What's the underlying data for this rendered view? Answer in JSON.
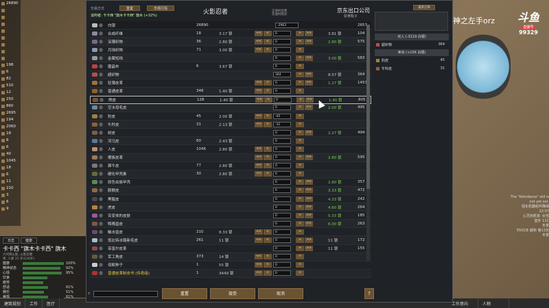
{
  "header": {
    "mode_label": "交易方式",
    "btn1": "重置",
    "btn2": "市场行情",
    "negotiator": "谈判者: 卡卡西 \"旗木卡卡西\" 旗木 (+32%)",
    "trader_name": "火影忍者",
    "faction": "京东出口公司",
    "faction_sub": "奴隶贩子",
    "positive": "正值时出售",
    "negative": "负值时购买",
    "right_btn": "请求订单"
  },
  "silver": {
    "name": "白银",
    "count": "26890",
    "field": "-2963",
    "trader_count": "2657"
  },
  "rows": [
    {
      "name": "合成纤维",
      "count": "18",
      "price": "3.17 银",
      "field": "0",
      "tprice": "3.81 银",
      "tcnt": "104",
      "g": false,
      "l": true,
      "r": true,
      "col": "#8a8aa0"
    },
    {
      "name": "深薄织物",
      "count": "36",
      "price": "2.80 银",
      "field": "0",
      "tprice": "2.80 银",
      "tcnt": "575",
      "g": true,
      "l": true,
      "r": true,
      "col": "#7a6a8a"
    },
    {
      "name": "月球织物",
      "count": "71",
      "price": "3.00 银",
      "field": "0",
      "tprice": "",
      "tcnt": "",
      "g": false,
      "l": true,
      "r": true,
      "col": "#8a9ab0"
    },
    {
      "name": "金属短线",
      "count": "",
      "price": "",
      "field": "0",
      "tprice": "3.00 银",
      "tcnt": "583",
      "g": true,
      "l": false,
      "r": false,
      "col": "#9a9a9a"
    },
    {
      "name": "魔晶布",
      "count": "6",
      "price": "3.67 银",
      "field": "0",
      "tprice": "",
      "tcnt": "",
      "g": false,
      "l": false,
      "r": true,
      "col": "#c04040"
    },
    {
      "name": "超织物",
      "count": "",
      "price": "",
      "field": "364",
      "tprice": "8.57 银",
      "tcnt": "364",
      "g": false,
      "l": false,
      "r": false,
      "col": "#b05050"
    },
    {
      "name": "轻薄皮革",
      "count": "",
      "price": "",
      "field": "0",
      "tprice": "1.27 银",
      "tcnt": "1453",
      "g": true,
      "l": true,
      "r": false,
      "col": "#a07040"
    },
    {
      "name": "普通皮革",
      "count": "348",
      "price": "1.40 银",
      "field": "0",
      "tprice": "",
      "tcnt": "",
      "g": false,
      "l": true,
      "r": true,
      "col": "#906030"
    },
    {
      "name": "熊皮",
      "count": "128",
      "price": "1.40 银",
      "field": "0",
      "tprice": "1.40 银",
      "tcnt": "805",
      "g": true,
      "l": true,
      "r": true,
      "col": "#7a5030",
      "hl": true
    },
    {
      "name": "空水母毛皮",
      "count": "",
      "price": "",
      "field": "0",
      "tprice": "2.00 银",
      "tcnt": "495",
      "g": true,
      "l": false,
      "r": false,
      "col": "#6a8aa0"
    },
    {
      "name": "豹皮",
      "count": "45",
      "price": "2.00 银",
      "field": "-45",
      "tprice": "",
      "tcnt": "",
      "g": false,
      "l": true,
      "r": true,
      "col": "#a08040"
    },
    {
      "name": "牛羚皮",
      "count": "31",
      "price": "2.13 银",
      "field": "-31",
      "tprice": "",
      "tcnt": "",
      "g": false,
      "l": true,
      "r": true,
      "col": "#8a6040"
    },
    {
      "name": "树皮",
      "count": "",
      "price": "",
      "field": "0",
      "tprice": "2.27 银",
      "tcnt": "494",
      "g": true,
      "l": false,
      "r": false,
      "col": "#7a6040"
    },
    {
      "name": "河马皮",
      "count": "60",
      "price": "2.43 银",
      "field": "0",
      "tprice": "",
      "tcnt": "",
      "g": false,
      "l": false,
      "r": true,
      "col": "#5a7a9a"
    },
    {
      "name": "人皮",
      "count": "1046",
      "price": "2.80 银",
      "field": "0",
      "tprice": "",
      "tcnt": "",
      "g": false,
      "l": true,
      "r": true,
      "col": "#c09070"
    },
    {
      "name": "哪族皮革",
      "count": "",
      "price": "",
      "field": "0",
      "tprice": "2.80 银",
      "tcnt": "595",
      "g": true,
      "l": true,
      "r": false,
      "col": "#9a7a5a"
    },
    {
      "name": "犀牛皮",
      "count": "77",
      "price": "2.80 银",
      "field": "0",
      "tprice": "",
      "tcnt": "",
      "g": false,
      "l": true,
      "r": true,
      "col": "#7a7a7a"
    },
    {
      "name": "硬化甲壳素",
      "count": "30",
      "price": "2.80 银",
      "field": "0",
      "tprice": "",
      "tcnt": "",
      "g": false,
      "l": true,
      "r": true,
      "col": "#6a6a40"
    },
    {
      "name": "原色虫族甲壳",
      "count": "",
      "price": "",
      "field": "0",
      "tprice": "2.80 银",
      "tcnt": "357",
      "g": true,
      "l": false,
      "r": false,
      "col": "#5a8a5a"
    },
    {
      "name": "豚猴皮",
      "count": "",
      "price": "",
      "field": "0",
      "tprice": "3.33 银",
      "tcnt": "472",
      "g": true,
      "l": false,
      "r": false,
      "col": "#8a6a4a"
    },
    {
      "name": "黑猩皮",
      "count": "",
      "price": "",
      "field": "0",
      "tprice": "4.33 银",
      "tcnt": "242",
      "g": true,
      "l": false,
      "r": false,
      "col": "#4a4a4a"
    },
    {
      "name": "虎皮",
      "count": "",
      "price": "",
      "field": "0",
      "tprice": "4.60 银",
      "tcnt": "264",
      "g": true,
      "l": false,
      "r": false,
      "col": "#c08030"
    },
    {
      "name": "突变体的皮肤",
      "count": "",
      "price": "",
      "field": "0",
      "tprice": "5.33 银",
      "tcnt": "185",
      "g": true,
      "l": false,
      "r": false,
      "col": "#9a5a9a"
    },
    {
      "name": "鸭嘴兽皮",
      "count": "",
      "price": "",
      "field": "0",
      "tprice": "6.00 银",
      "tcnt": "263",
      "g": true,
      "l": false,
      "r": false,
      "col": "#7a5a4a"
    },
    {
      "name": "触击兽皮",
      "count": "210",
      "price": "8.33 银",
      "field": "0",
      "tprice": "",
      "tcnt": "",
      "g": false,
      "l": true,
      "r": true,
      "col": "#6a4a6a"
    },
    {
      "name": "低比特冰路新毛皮",
      "count": "261",
      "price": "11 银",
      "field": "0",
      "tprice": "11 银",
      "tcnt": "172",
      "g": false,
      "l": true,
      "r": true,
      "col": "#aabbcc"
    },
    {
      "name": "菲奎尔皮革",
      "count": "",
      "price": "",
      "field": "0",
      "tprice": "11 银",
      "tcnt": "155",
      "g": false,
      "l": false,
      "r": false,
      "col": "#8a4a4a"
    },
    {
      "name": "军工角皮",
      "count": "373",
      "price": "14 银",
      "field": "0",
      "tprice": "",
      "tcnt": "",
      "g": false,
      "l": true,
      "r": true,
      "col": "#6a5a3a"
    },
    {
      "name": "母鲛种子",
      "count": "1",
      "price": "55 银",
      "field": "0",
      "tprice": "",
      "tcnt": "",
      "g": false,
      "l": true,
      "r": true,
      "col": "#cccccc"
    },
    {
      "name": "普通皮革制衣书 (传奇级)",
      "count": "1",
      "price": "3449 银",
      "field": "0",
      "tprice": "",
      "tcnt": "",
      "g": false,
      "l": true,
      "r": true,
      "col": "#aa3333",
      "yellow": true
    }
  ],
  "tradeside": {
    "buy_header": "买入 (-3119 白银)",
    "buy_items": [
      {
        "name": "超织物",
        "count": "364"
      }
    ],
    "sell_header": "卖出 (+156 白银)",
    "sell_items": [
      {
        "name": "豹皮",
        "count": "45"
      },
      {
        "name": "牛羚皮",
        "count": "31"
      }
    ]
  },
  "footer": {
    "reset": "重置",
    "accept": "接受",
    "cancel": "取消",
    "help": "?"
  },
  "overlay": {
    "watermark": "神之左手orz",
    "logo_big": "斗鱼",
    "logo_tag": "直播号",
    "logo_num": "99329",
    "log_lines": [
      "The \"Kotodama\" skil is",
      "not yet set.",
      "强化机器组件确保",
      "22:07",
      "心灵抚慰波: 女性",
      "室外 11C",
      "冬季",
      "5501年 越秋 第13天",
      "冬季"
    ]
  },
  "left": {
    "counts": [
      "26890",
      "",
      "",
      "",
      "",
      "",
      "",
      "",
      "",
      "198",
      "6",
      "82",
      "510",
      "12",
      "250",
      "860",
      "2695",
      "194",
      "2060",
      "18",
      "8",
      "6",
      "40",
      "1045",
      "18",
      "6",
      "11",
      "210",
      "3",
      "6",
      "9"
    ],
    "tabs": [
      "日志",
      "健康"
    ],
    "colonist_name": "卡卡西 \"旗木卡卡西\" 旗木",
    "colonist_sub": "六代目火影, 火影忍者",
    "colonist_sub2": "男, 人类 15 岁(124岁)",
    "bars": [
      {
        "label": "健康",
        "pct": "100%",
        "fill": 1.0
      },
      {
        "label": "精神状态",
        "pct": "92%",
        "fill": 0.92
      },
      {
        "label": "心情",
        "pct": "95%",
        "fill": 0.95
      },
      {
        "label": "饮食",
        "pct": "",
        "fill": 0.6
      },
      {
        "label": "疲劳",
        "pct": "",
        "fill": 0.5
      },
      {
        "label": "舒适",
        "pct": "61%",
        "fill": 0.61
      },
      {
        "label": "娱乐",
        "pct": "51%",
        "fill": 0.51
      },
      {
        "label": "美观",
        "pct": "61%",
        "fill": 0.61
      }
    ],
    "current": "当前任务: 谈判交易",
    "bottom_tabs": [
      "建筑规划",
      "工作",
      "医疗"
    ]
  },
  "right_bottom": {
    "tab_work": "工作意向",
    "tab_people": "人物"
  }
}
